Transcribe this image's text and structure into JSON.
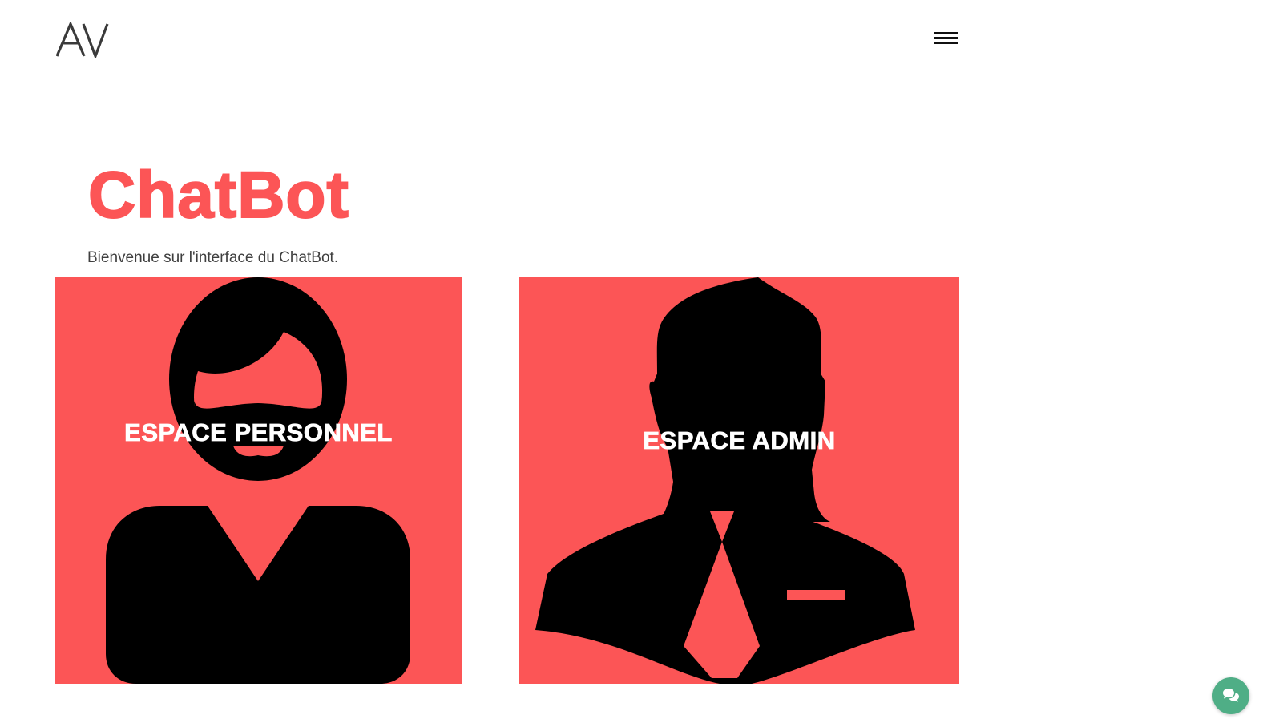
{
  "header": {
    "logo_text": "AV",
    "menu_icon": "hamburger-menu-icon"
  },
  "hero": {
    "title": "ChatBot",
    "subtitle": "Bienvenue sur l'interface du ChatBot."
  },
  "cards": [
    {
      "label": "ESPACE PERSONNEL",
      "icon": "user-avatar-icon"
    },
    {
      "label": "ESPACE ADMIN",
      "icon": "admin-suit-icon"
    }
  ],
  "chat_widget": {
    "icon": "chat-bubbles-icon"
  },
  "colors": {
    "accent": "#fc5556",
    "text": "#3f3f3f",
    "chat_button": "#4fae86",
    "figure": "#000000"
  }
}
